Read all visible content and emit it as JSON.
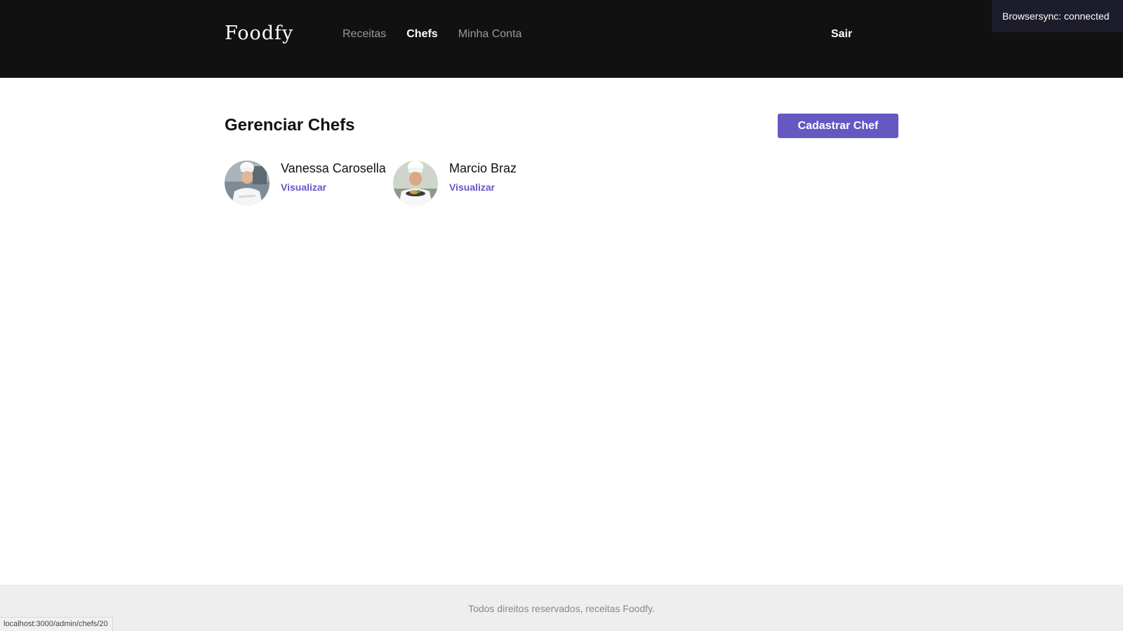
{
  "header": {
    "logo": "Foodfy",
    "nav": [
      {
        "label": "Receitas",
        "active": false
      },
      {
        "label": "Chefs",
        "active": true
      },
      {
        "label": "Minha Conta",
        "active": false
      }
    ],
    "logout_label": "Sair"
  },
  "browsersync": {
    "text": "Browsersync: connected"
  },
  "main": {
    "title": "Gerenciar Chefs",
    "create_button_label": "Cadastrar Chef",
    "chefs": [
      {
        "name": "Vanessa Carosella",
        "link_label": "Visualizar"
      },
      {
        "name": "Marcio Braz",
        "link_label": "Visualizar"
      }
    ]
  },
  "footer": {
    "text": "Todos direitos reservados, receitas Foodfy."
  },
  "status_bar": {
    "url": "localhost:3000/admin/chefs/20"
  },
  "colors": {
    "accent": "#6558c3",
    "header_bg": "#111111",
    "footer_bg": "#eeeeee"
  }
}
